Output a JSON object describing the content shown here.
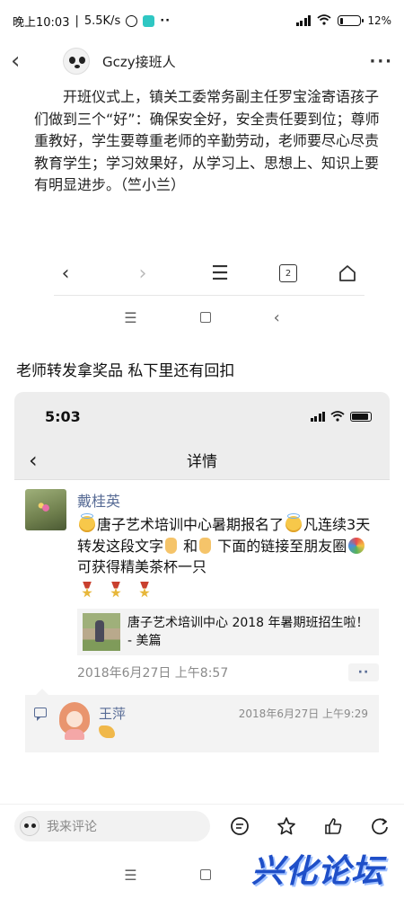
{
  "status_bar": {
    "time": "晚上10:03",
    "speed": "5.5K/s",
    "battery": "12%"
  },
  "app_bar": {
    "title": "Gczy接班人"
  },
  "article": {
    "text": "开班仪式上，镇关工委常务副主任罗宝淦寄语孩子们做到三个“好”：确保安全好，安全责任要到位；尊师重教好，学生要尊重老师的辛勤劳动，老师要尽心尽责教育学生；学习效果好，从学习上、思想上、知识上要有明显进步。（竺小兰）"
  },
  "browser_nav": {
    "tab_count": "2"
  },
  "headline": "老师转发拿奖品 私下里还有回扣",
  "phone": {
    "time": "5:03",
    "header_title": "详情",
    "post": {
      "author": "戴桂英",
      "text_1": "唐子艺术培训中心暑期报名了",
      "text_2": "凡连续3天转发这段文字",
      "text_3": "和",
      "text_4": "下面的链接至朋友圈",
      "text_5": "可获得精美茶杯一只",
      "link_title": "唐子艺术培训中心 2018 年暑期班招生啦！ - 美篇",
      "time": "2018年6月27日 上午8:57"
    },
    "comment": {
      "name": "王萍",
      "time": "2018年6月27日 上午9:29"
    }
  },
  "bottom_bar": {
    "placeholder": "我来评论"
  },
  "watermark": "兴化论坛"
}
